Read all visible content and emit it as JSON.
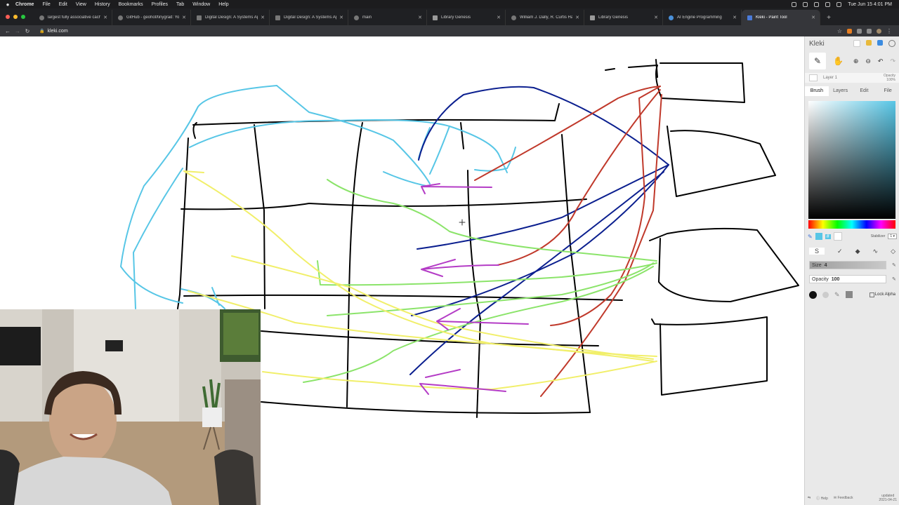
{
  "menubar": {
    "apple": "",
    "app_name": "Chrome",
    "items": [
      "File",
      "Edit",
      "View",
      "History",
      "Bookmarks",
      "Profiles",
      "Tab",
      "Window",
      "Help"
    ],
    "clock": "Tue Jun 15  4:01 PM"
  },
  "tabs": [
    {
      "title": "largest fully associative cache"
    },
    {
      "title": "GitHub - geohot/tinygrad: Yo"
    },
    {
      "title": "Digital Design: A Systems Ap"
    },
    {
      "title": "Digital Design: A Systems Ap"
    },
    {
      "title": "main"
    },
    {
      "title": "Library Genesis"
    },
    {
      "title": "William J. Dally, R. Curtis Har"
    },
    {
      "title": "Library Genesis"
    },
    {
      "title": "AI Engine Programming"
    },
    {
      "title": "Kleki - Paint Tool",
      "active": true
    }
  ],
  "new_tab": "+",
  "address": {
    "url": "kleki.com"
  },
  "kleki": {
    "logo": "Kleki",
    "layer_name": "Layer 1",
    "layer_opacity_label": "Opacity",
    "layer_opacity_value": "100%",
    "tabs": [
      "Brush",
      "Layers",
      "Edit",
      "File"
    ],
    "active_tab": "Brush",
    "hex_symbol": "#",
    "current_color": "#57c6e6",
    "stabilizer_label": "Stabilizer",
    "stabilizer_value": "1",
    "size_label": "Size",
    "size_value": "4",
    "opacity_label": "Opacity",
    "opacity_value": "100",
    "lock_alpha": "Lock Alpha",
    "help": "Help",
    "feedback": "Feedback",
    "updated_label": "updated",
    "updated_date": "2021-04-21"
  },
  "colors": {
    "black": "#000000",
    "cyan": "#57c6e6",
    "navy": "#0b1f8f",
    "red": "#c0392b",
    "green": "#8be46a",
    "yellow": "#f1ef6a",
    "magenta": "#b43cc6"
  }
}
